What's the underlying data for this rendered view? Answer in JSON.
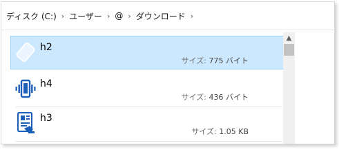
{
  "breadcrumb": {
    "items": [
      "ディスク (C:)",
      "ユーザー",
      "@",
      "ダウンロード"
    ],
    "separator": "›"
  },
  "files": [
    {
      "name": "h2",
      "size_label": "サイズ:",
      "size_value": "775 バイト",
      "icon": "blank-file-icon",
      "selected": true
    },
    {
      "name": "h4",
      "size_label": "サイズ:",
      "size_value": "436 バイト",
      "icon": "vibrate-phone-icon",
      "selected": false
    },
    {
      "name": "h3",
      "size_label": "サイズ:",
      "size_value": "1.05 KB",
      "icon": "document-stamp-icon",
      "selected": false
    }
  ],
  "colors": {
    "selection_fill": "#cce8ff",
    "selection_border": "#99d1ff",
    "icon_blue": "#1c5fb8"
  }
}
